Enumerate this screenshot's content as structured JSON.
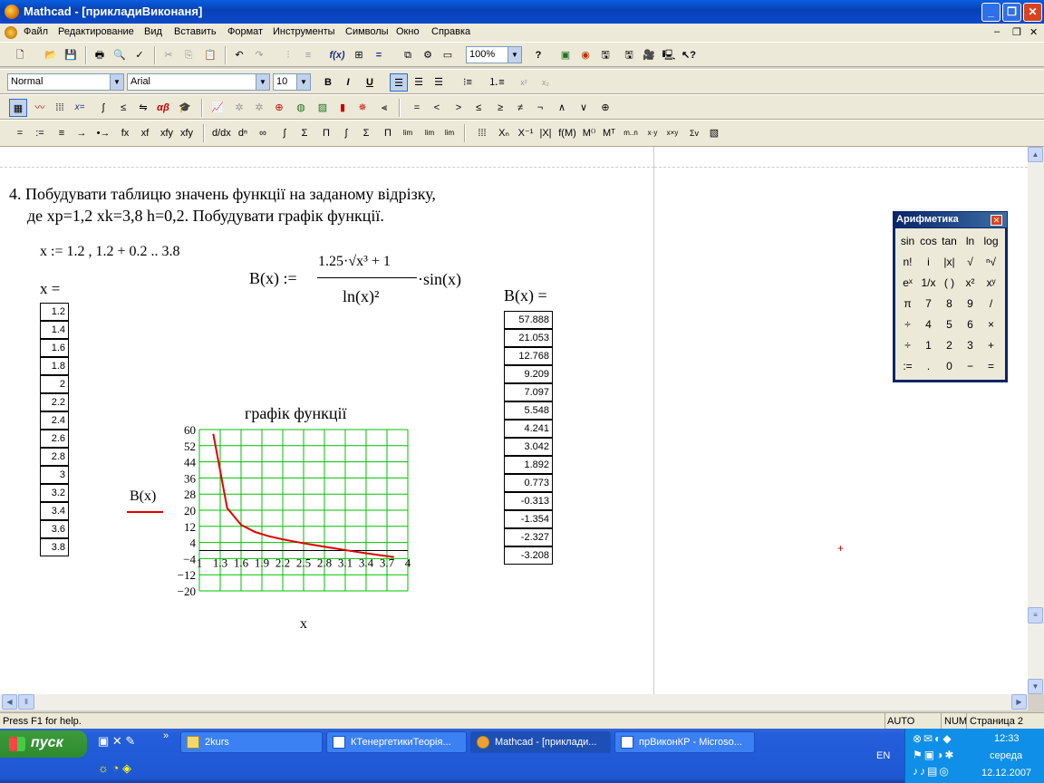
{
  "window": {
    "title": "Mathcad - [прикладиВиконаня]"
  },
  "menu": [
    "Файл",
    "Редактирование",
    "Вид",
    "Вставить",
    "Формат",
    "Инструменты",
    "Символы",
    "Окно",
    "Справка"
  ],
  "format_bar": {
    "style": "Normal",
    "font": "Arial",
    "size": "10"
  },
  "standard_bar": {
    "zoom": "100%"
  },
  "math_bar1": [
    "=",
    "<",
    ">",
    "≤",
    "≥",
    "≠",
    "¬",
    "∧",
    "∨",
    "⊕"
  ],
  "math_bar2": [
    "=",
    ":=",
    "≡",
    "→",
    "•→",
    "fx",
    "xf",
    "xfy",
    "xfy"
  ],
  "task": {
    "line1": "4. Побудувати таблицю значень функції на заданому відрізку,",
    "line2": "де xp=1,2  xk=3,8 h=0,2. Побудувати графік функції."
  },
  "defs": {
    "x_def": "x := 1.2 , 1.2 + 0.2 .. 3.8",
    "x_eq": "x =",
    "b_eq": "B(x) =",
    "b_lhs": "B(x) :=",
    "b_num": "1.25·√x³ + 1",
    "b_den": "ln(x)²",
    "b_tail": "·sin(x)"
  },
  "x_values": [
    "1.2",
    "1.4",
    "1.6",
    "1.8",
    "2",
    "2.2",
    "2.4",
    "2.6",
    "2.8",
    "3",
    "3.2",
    "3.4",
    "3.6",
    "3.8"
  ],
  "b_values": [
    "57.888",
    "21.053",
    "12.768",
    "9.209",
    "7.097",
    "5.548",
    "4.241",
    "3.042",
    "1.892",
    "0.773",
    "-0.313",
    "-1.354",
    "-2.327",
    "-3.208"
  ],
  "chart_data": {
    "type": "line",
    "title": "графік функції",
    "xlabel": "x",
    "ylabel": "B(x)",
    "series": [
      {
        "name": "B(x)",
        "color": "#e00000",
        "x": [
          1.2,
          1.4,
          1.6,
          1.8,
          2,
          2.2,
          2.4,
          2.6,
          2.8,
          3,
          3.2,
          3.4,
          3.6,
          3.8
        ],
        "y": [
          57.888,
          21.053,
          12.768,
          9.209,
          7.097,
          5.548,
          4.241,
          3.042,
          1.892,
          0.773,
          -0.313,
          -1.354,
          -2.327,
          -3.208
        ]
      }
    ],
    "xlim": [
      1,
      4
    ],
    "ylim": [
      -20,
      60
    ],
    "xticks": [
      "1",
      "1.3",
      "1.6",
      "1.9",
      "2.2",
      "2.5",
      "2.8",
      "3.1",
      "3.4",
      "3.7",
      "4"
    ],
    "yticks": [
      "60",
      "52",
      "44",
      "36",
      "28",
      "20",
      "12",
      "4",
      "−4",
      "−12",
      "−20"
    ],
    "grid": true,
    "grid_color": "#00c000"
  },
  "palette": {
    "title": "Арифметика",
    "keys": [
      [
        "sin",
        "cos",
        "tan",
        "ln",
        "log"
      ],
      [
        "n!",
        "i",
        "|x|",
        "√",
        "ⁿ√"
      ],
      [
        "eˣ",
        "1/x",
        "( )",
        "x²",
        "xʸ"
      ],
      [
        "π",
        "7",
        "8",
        "9",
        "/"
      ],
      [
        "÷",
        "4",
        "5",
        "6",
        "×"
      ],
      [
        "÷",
        "1",
        "2",
        "3",
        "+"
      ],
      [
        ":=",
        ".",
        "0",
        "−",
        "="
      ]
    ]
  },
  "status": {
    "help": "Press F1 for help.",
    "auto": "AUTO",
    "num": "NUM",
    "page": "Страница 2"
  },
  "taskbar": {
    "start": "пуск",
    "tasks": [
      "2kurs",
      "КТенергетикиТеорія...",
      "Mathcad - [приклади...",
      "прВиконКР - Microso..."
    ],
    "lang": "EN",
    "time": "12:33",
    "day": "середа",
    "date": "12.12.2007"
  }
}
